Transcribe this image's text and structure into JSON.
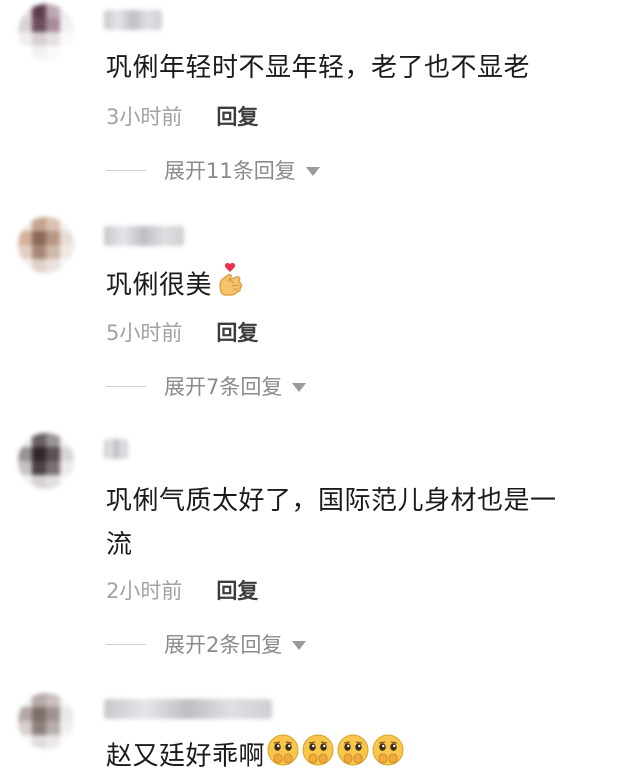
{
  "comments": [
    {
      "text": "巩俐年轻时不显年轻，老了也不显老",
      "time": "3小时前",
      "reply_label": "回复",
      "expand_label": "展开11条回复"
    },
    {
      "text": "巩俐很美",
      "emoji": "finger-heart-emoji",
      "time": "5小时前",
      "reply_label": "回复",
      "expand_label": "展开7条回复"
    },
    {
      "text_line1": "巩俐气质太好了，国际范儿身材也是一",
      "text_line2": "流",
      "time": "2小时前",
      "reply_label": "回复",
      "expand_label": "展开2条回复"
    },
    {
      "text": "赵又廷好乖啊",
      "emoji": "hand-over-mouth-face-emoji",
      "emoji_count": 4
    }
  ],
  "colors": {
    "text": "#1b1b1b",
    "time": "#a2a2a2",
    "reply": "#3d3d3d",
    "expand": "#8b8b8b",
    "emoji_face": "#f7c64a"
  }
}
